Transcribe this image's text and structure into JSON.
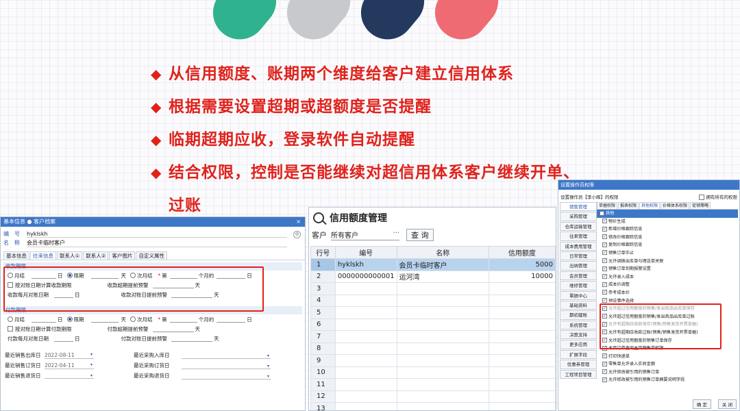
{
  "bullets": [
    {
      "mark": "◆",
      "text": "从信用额度、账期两个维度给客户建立信用体系"
    },
    {
      "mark": "◆",
      "text": "根据需要设置超期或超额度是否提醒"
    },
    {
      "mark": "◆",
      "text": "临期超期应收，登录软件自动提醒"
    },
    {
      "mark": "◆",
      "text": "结合权限，控制是否能继续对超信用体系客户继续开单、"
    },
    {
      "mark": "",
      "text": "过账"
    }
  ],
  "colors": {
    "accent_red": "#e0221b",
    "title_blue": "#3d77c8",
    "pill1": "#2fb38e",
    "pill2": "#c8c9cc",
    "pill3": "#233a5e",
    "pill4": "#ef6b73"
  },
  "left_window": {
    "title": "基本信息 ● 客户档案",
    "close": "×",
    "code_label": "编　号",
    "code_value": "hyklskh",
    "name_label": "名　称",
    "name_value": "会员卡临时客户",
    "tabs": [
      "基本信息",
      "往来信息",
      "联系人①",
      "联系人②",
      "客户图片",
      "自定义属性"
    ],
    "receive_group": {
      "title": "收款期限",
      "monthly": "月结",
      "day": "日",
      "limit": "限期",
      "days": "天",
      "next_month": "次月结",
      "star": "*",
      "nth": "第",
      "months_after": "个月的",
      "day2": "日",
      "by_bill_date": "按对账日期计算收款期限",
      "advance_warn": "收款超期提前预警",
      "days2": "天",
      "monthly_bill_day": "收款每月对账日期",
      "day3": "日",
      "bill_day_warn": "收款对账日提前预警",
      "days3": "天"
    },
    "pay_group": {
      "title": "付款期限",
      "monthly": "月结",
      "day": "日",
      "limit": "限期",
      "days": "天",
      "next_month": "次月结",
      "star": "*",
      "nth": "第",
      "months_after": "个月的",
      "day2": "日",
      "by_bill_date": "按对账日期计算付款期限",
      "advance_warn": "付款超期提前预警",
      "days2": "天",
      "monthly_bill_day": "付款每月对账日期",
      "day3": "日",
      "bill_day_warn": "付款对账日提前预警",
      "days3": "天"
    },
    "dates": [
      {
        "label": "最近销售出库日",
        "value": "2022-08-11",
        "label2": "最近采购入库日"
      },
      {
        "label": "最近销售订货日",
        "value": "2022-04-11",
        "label2": "最近采购订货日"
      },
      {
        "label": "最近销售退货日",
        "value": "",
        "label2": "最近采购退货日"
      }
    ],
    "caret": "▾"
  },
  "mid_window": {
    "title": "信用额度管理",
    "customer_label": "客户",
    "customer_value": "所有客户",
    "dots": "···",
    "query_button": "查 询",
    "columns": [
      "行号",
      "编号",
      "名称",
      "信用额度"
    ],
    "rows": [
      {
        "n": "1",
        "code": "hyklskh",
        "name": "会员卡临时客户",
        "credit": "5000"
      },
      {
        "n": "2",
        "code": "0000000000001",
        "name": "运河湾",
        "credit": "10000"
      },
      {
        "n": "3",
        "code": "",
        "name": "",
        "credit": ""
      },
      {
        "n": "4",
        "code": "",
        "name": "",
        "credit": ""
      },
      {
        "n": "5",
        "code": "",
        "name": "",
        "credit": ""
      },
      {
        "n": "6",
        "code": "",
        "name": "",
        "credit": ""
      },
      {
        "n": "7",
        "code": "",
        "name": "",
        "credit": ""
      },
      {
        "n": "8",
        "code": "",
        "name": "",
        "credit": ""
      },
      {
        "n": "9",
        "code": "",
        "name": "",
        "credit": ""
      },
      {
        "n": "10",
        "code": "",
        "name": "",
        "credit": ""
      },
      {
        "n": "11",
        "code": "",
        "name": "",
        "credit": ""
      },
      {
        "n": "12",
        "code": "",
        "name": "",
        "credit": ""
      },
      {
        "n": "13",
        "code": "",
        "name": "",
        "credit": ""
      }
    ]
  },
  "right_window": {
    "title": "设置操作员权限",
    "operator_text": "设置操作员【李小辉】的权限",
    "all_perms": "拥有所有的权限",
    "side": [
      "销售管理",
      "采购管理",
      "仓库运输管理",
      "往来管理",
      "成本费用管理",
      "日常管理",
      "出纳管理",
      "会员管理",
      "维修管理",
      "單据中心",
      "基础资料",
      "期初建账",
      "系统管理",
      "决策支持",
      "更多应用",
      "扩展字段",
      "优惠券管理",
      "工程项目管理"
    ],
    "tabs": [
      "单据权限",
      "报表权限",
      "其他权限",
      "价格体系权限",
      "促销策略"
    ],
    "items": [
      {
        "text": "其他",
        "checked": false,
        "hdr": true
      },
      {
        "text": "物价生成",
        "checked": true
      },
      {
        "text": "新增价格跟踪信息",
        "checked": true
      },
      {
        "text": "修改价格跟踪信息",
        "checked": true
      },
      {
        "text": "复制价格跟踪信息",
        "checked": true
      },
      {
        "text": "销售订单中止",
        "checked": true
      },
      {
        "text": "允许调拨出库单与理送单关联",
        "checked": true
      },
      {
        "text": "销售订单到期报警设置",
        "checked": true
      },
      {
        "text": "允许录入成本",
        "checked": true
      },
      {
        "text": "成本价调整",
        "checked": true
      },
      {
        "text": "参考成本价",
        "checked": true
      },
      {
        "text": "预设事件选择",
        "checked": true
      },
      {
        "text": "允许超过信用额度的销售/发出商品出库单保存",
        "checked": true,
        "dim": true
      },
      {
        "text": "允许超过信用额度的销售/发出商品出库单过账",
        "checked": true
      },
      {
        "text": "允许有超期应收款保存(销售/销售发货开票单据)",
        "checked": true,
        "dim": true
      },
      {
        "text": "允许有超期应收款过账(销售/销售发货开票单据)",
        "checked": true
      },
      {
        "text": "允许超过信用额度的销售订单保存",
        "checked": true
      },
      {
        "text": "本页订单查询主页销售单权限",
        "checked": true
      },
      {
        "text": "打印快递单",
        "checked": true
      },
      {
        "text": "零售单允许录入实收金额",
        "checked": true
      },
      {
        "text": "允许修改被引用的销售订单",
        "checked": true
      },
      {
        "text": "允许修改被引用的销售订单摘要说明字段",
        "checked": true
      }
    ],
    "ok_button": "确 定",
    "close_button": "关 闭"
  }
}
